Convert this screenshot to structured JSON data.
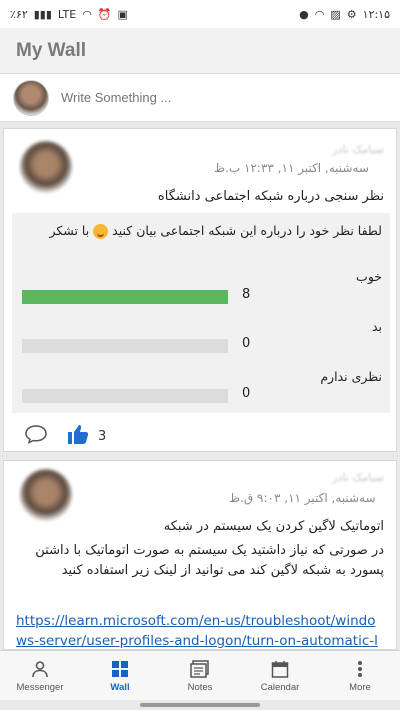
{
  "status_bar": {
    "battery": "٪۶۲",
    "time": "۱۲:۱۵",
    "network": "LTE"
  },
  "app": {
    "title": "My Wall"
  },
  "composer": {
    "placeholder": "Write Something ..."
  },
  "posts": [
    {
      "author": "سیامک نادر",
      "time": "سه‌شنبه, اکتبر ۱۱, ۱۲:۳۳ ب.ظ",
      "title": "نظر سنجی درباره شبکه اجتماعی دانشگاه",
      "poll": {
        "question": "لطفا نظر خود را درباره این شبکه اجتماعی بیان کنید",
        "question_tail": "با تشکر",
        "options": [
          {
            "label": "خوب",
            "count": 8,
            "fraction": 1.0
          },
          {
            "label": "بد",
            "count": 0,
            "fraction": 0.0
          },
          {
            "label": "نظری ندارم",
            "count": 0,
            "fraction": 0.0
          }
        ]
      },
      "likes": "3"
    },
    {
      "author": "سیامک نادر",
      "time": "سه‌شنبه, اکتبر ۱۱, ۹:۰۳ ق.ظ",
      "title": "اتوماتیک لاگین کردن یک سیستم در شبکه",
      "body": "در صورتی که نیاز داشتید یک سیستم به صورت اتوماتیک با داشتن پسورد به شبکه لاگین کند می توانید از لینک زیر استفاده کنید",
      "link": "https://learn.microsoft.com/en-us/troubleshoot/windows-server/user-profiles-and-logon/turn-on-automatic-logon"
    }
  ],
  "nav": {
    "items": [
      {
        "label": "Messenger",
        "icon": "person-icon"
      },
      {
        "label": "Wall",
        "icon": "grid-icon"
      },
      {
        "label": "Notes",
        "icon": "notes-icon"
      },
      {
        "label": "Calendar",
        "icon": "calendar-icon"
      },
      {
        "label": "More",
        "icon": "more-icon"
      }
    ],
    "active": "Wall"
  },
  "colors": {
    "accent": "#1565c0",
    "poll_fill": "#5cb85c",
    "link": "#1a5fb4"
  }
}
